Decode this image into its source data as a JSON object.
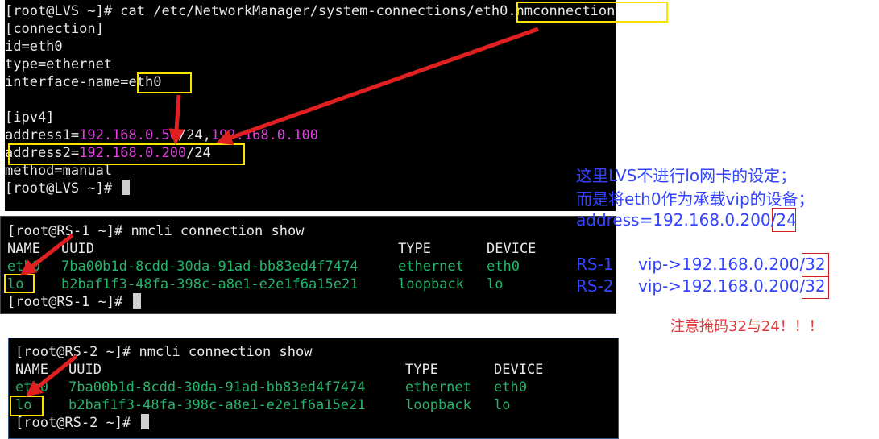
{
  "terminal1": {
    "prompt": "[root@LVS ~]# ",
    "command": "cat /etc/NetworkManager/system-connections/eth0.nmconnection",
    "line_connection": "[connection]",
    "line_id": "id=eth0",
    "line_type": "type=ethernet",
    "line_iface_key": "interface-name=",
    "line_iface_val": "eth0",
    "line_ipv4": "[ipv4]",
    "addr1_key": "address1=",
    "addr1_ip": "192.168.0.50",
    "addr1_rest": "/24,",
    "addr1_gw": "192.168.0.100",
    "addr2_key": "address2=",
    "addr2_ip": "192.168.0.200",
    "addr2_mask": "/24",
    "line_method": "method=manual",
    "prompt_end": "[root@LVS ~]# "
  },
  "terminal2": {
    "prompt_cmd": "[root@RS-1 ~]# nmcli connection show",
    "headers": [
      "NAME",
      "UUID",
      "TYPE",
      "DEVICE"
    ],
    "rows": [
      {
        "name": "eth0",
        "uuid": "7ba00b1d-8cdd-30da-91ad-bb83ed4f7474",
        "type": "ethernet",
        "device": "eth0"
      },
      {
        "name": "lo",
        "uuid": "b2baf1f3-48fa-398c-a8e1-e2e1f6a15e21",
        "type": "loopback",
        "device": "lo"
      }
    ],
    "prompt_end": "[root@RS-1 ~]# "
  },
  "terminal3": {
    "prompt_cmd": "[root@RS-2 ~]# nmcli connection show",
    "headers": [
      "NAME",
      "UUID",
      "TYPE",
      "DEVICE"
    ],
    "rows": [
      {
        "name": "eth0",
        "uuid": "7ba00b1d-8cdd-30da-91ad-bb83ed4f7474",
        "type": "ethernet",
        "device": "eth0"
      },
      {
        "name": "lo",
        "uuid": "b2baf1f3-48fa-398c-a8e1-e2e1f6a15e21",
        "type": "loopback",
        "device": "lo"
      }
    ],
    "prompt_end": "[root@RS-2 ~]# "
  },
  "notes": {
    "line1": "这里LVS不进行lo网卡的设定；",
    "line2": "而是将eth0作为承载vip的设备；",
    "line3_pre": "address=192.168.0.200/",
    "line3_mask": "24",
    "rs1_label": "RS-1",
    "rs1_pre": "vip->192.168.0.200/",
    "rs1_mask": "32",
    "rs2_label": "RS-2",
    "rs2_pre": "vip->192.168.0.200/",
    "rs2_mask": "32",
    "warning": "注意掩码32与24！！！"
  },
  "colors": {
    "ip_highlight": "#e040e0",
    "nmcli_green": "#23b56a",
    "annotation_box": "#ffe100",
    "arrow_red": "#e02020",
    "note_blue": "#3344ff",
    "warning_red": "#e03a3a"
  }
}
